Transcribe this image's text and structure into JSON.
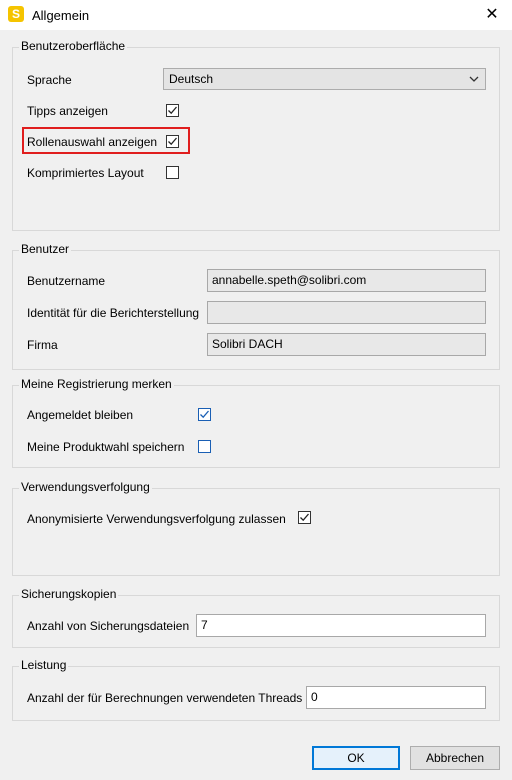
{
  "window": {
    "title": "Allgemein",
    "app_icon_letter": "S",
    "close_glyph": "✕"
  },
  "ui": {
    "title": "Benutzeroberfläche",
    "language_label": "Sprache",
    "language_value": "Deutsch",
    "show_tips_label": "Tipps anzeigen",
    "show_tips_checked": true,
    "role_select_label": "Rollenauswahl anzeigen",
    "role_select_checked": true,
    "compact_layout_label": "Komprimiertes Layout",
    "compact_layout_checked": false
  },
  "user": {
    "title": "Benutzer",
    "username_label": "Benutzername",
    "username_value": "annabelle.speth@solibri.com",
    "report_identity_label": "Identität für die Berichterstellung",
    "report_identity_value": "",
    "company_label": "Firma",
    "company_value": "Solibri DACH"
  },
  "registration": {
    "title": "Meine Registrierung merken",
    "stay_logged_label": "Angemeldet bleiben",
    "stay_logged_checked": true,
    "save_product_label": "Meine Produktwahl speichern",
    "save_product_checked": false
  },
  "tracking": {
    "title": "Verwendungsverfolgung",
    "anon_label": "Anonymisierte Verwendungsverfolgung zulassen",
    "anon_checked": true
  },
  "backups": {
    "title": "Sicherungskopien",
    "count_label": "Anzahl von Sicherungsdateien",
    "count_value": "7"
  },
  "performance": {
    "title": "Leistung",
    "threads_label": "Anzahl der für Berechnungen verwendeten Threads",
    "threads_value": "0"
  },
  "buttons": {
    "ok": "OK",
    "cancel": "Abbrechen"
  },
  "colors": {
    "highlight": "#e01e1e",
    "accent": "#1a5fb4",
    "app_icon": "#f5c400"
  }
}
